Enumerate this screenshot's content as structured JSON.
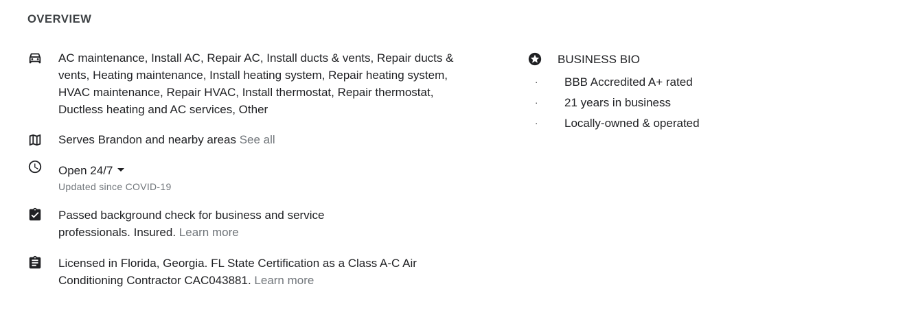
{
  "overview": {
    "title": "OVERVIEW",
    "services": {
      "icon": "car-icon",
      "text": "AC maintenance, Install AC, Repair AC, Install ducts & vents, Repair ducts & vents, Heating maintenance, Install heating system, Repair heating system, HVAC maintenance, Repair HVAC, Install thermostat, Repair thermostat, Ductless heating and AC services, Other"
    },
    "service_area": {
      "icon": "map-icon",
      "text": "Serves Brandon and nearby areas",
      "link": "See all"
    },
    "hours": {
      "icon": "clock-icon",
      "text": "Open 24/7",
      "updated": "Updated since COVID-19"
    },
    "background_check": {
      "icon": "clipboard-check-icon",
      "text": "Passed background check for business and service professionals. Insured.",
      "link": "Learn more"
    },
    "license": {
      "icon": "clipboard-icon",
      "text": "Licensed in Florida, Georgia. FL State Certification as a Class A-C Air Conditioning Contractor CAC043881.",
      "link": "Learn more"
    }
  },
  "business_bio": {
    "icon": "star-circle-icon",
    "title": "BUSINESS BIO",
    "bullet": "·",
    "items": [
      "BBB Accredited A+ rated",
      "21 years in business",
      "Locally-owned & operated"
    ]
  }
}
